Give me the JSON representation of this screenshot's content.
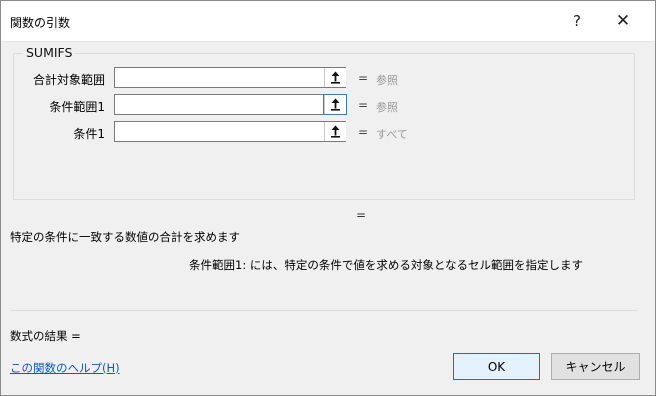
{
  "window": {
    "title": "関数の引数",
    "help_label": "?",
    "close_label": "✕"
  },
  "function": {
    "name": "SUMIFS"
  },
  "arguments": [
    {
      "label": "合計対象範囲",
      "value": "",
      "equals": "=",
      "result": "参照"
    },
    {
      "label": "条件範囲1",
      "value": "",
      "equals": "=",
      "result": "参照"
    },
    {
      "label": "条件1",
      "value": "",
      "equals": "=",
      "result": "すべて"
    }
  ],
  "result_equals": "=",
  "description": "特定の条件に一致する数値の合計を求めます",
  "argument_description": "条件範囲1:   には、特定の条件で値を求める対象となるセル範囲を指定します",
  "formula_result_label": "数式の結果 =",
  "help_link": "この関数のヘルプ(H)",
  "buttons": {
    "ok": "OK",
    "cancel": "キャンセル"
  },
  "icons": {
    "collapse_dialog": "collapse-dialog-icon"
  },
  "colors": {
    "focus": "#3a78c8",
    "link": "#0a5bc4",
    "ok_border": "#0078d7"
  }
}
